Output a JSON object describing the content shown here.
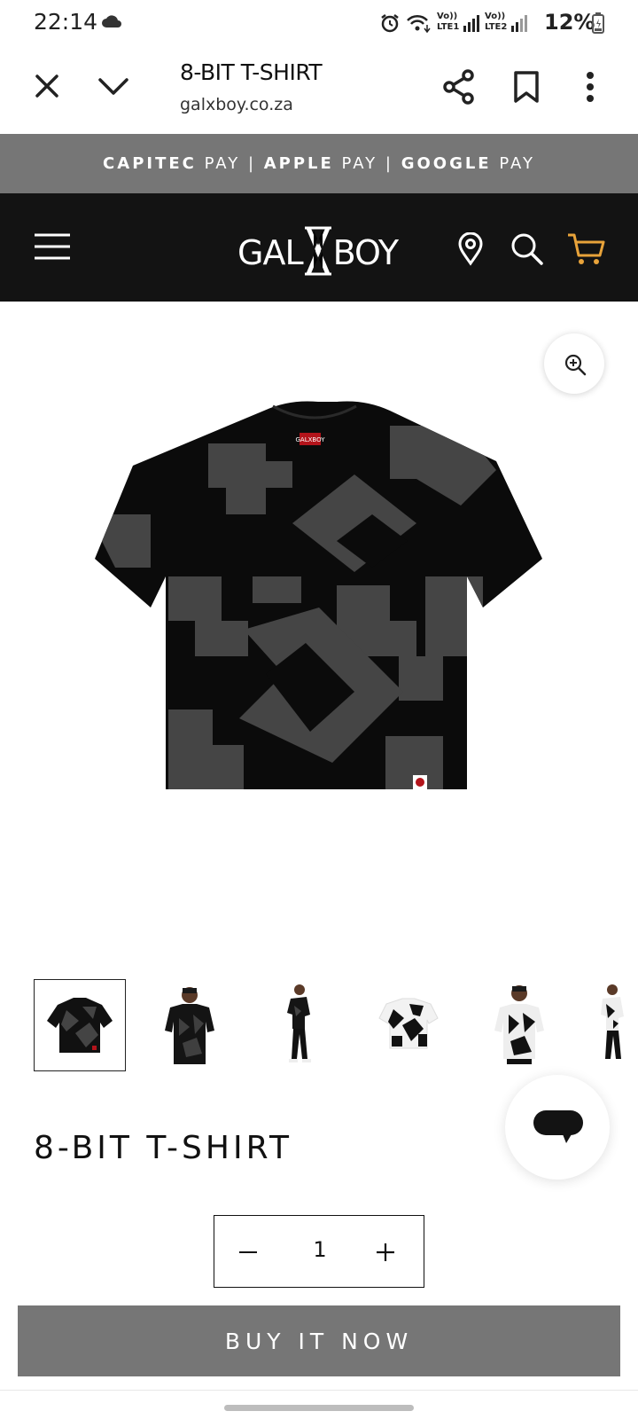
{
  "status_bar": {
    "time": "22:14",
    "battery": "12%",
    "sim1": {
      "volte": "Vo))",
      "type": "LTE1"
    },
    "sim2": {
      "volte": "Vo))",
      "type": "LTE2"
    },
    "icons": [
      "cloud-icon",
      "alarm-icon",
      "wifi-icon",
      "signal-icon",
      "battery-charging-icon"
    ]
  },
  "browser": {
    "title": "8-BIT T-SHIRT",
    "url": "galxboy.co.za",
    "icons": [
      "close-icon",
      "chevron-down-icon",
      "share-icon",
      "bookmark-icon",
      "more-vert-icon"
    ]
  },
  "promo": {
    "segments": [
      {
        "bold": "CAPITEC",
        "rest": " PAY"
      },
      {
        "bold": "APPLE",
        "rest": " PAY"
      },
      {
        "bold": "GOOGLE",
        "rest": " PAY"
      }
    ],
    "separator": " | "
  },
  "header": {
    "logo": "GALXBOY",
    "logo_left": "GAL",
    "logo_right": "BOY",
    "icons": [
      "menu-icon",
      "location-pin-icon",
      "search-icon",
      "cart-icon"
    ],
    "cart_color": "#e8a33a"
  },
  "product": {
    "title": "8-BIT T-SHIRT",
    "label_text": "GALXBOY",
    "quantity": "1",
    "buy_label": "BUY IT NOW",
    "thumbnails": [
      "tee-black-flat",
      "model-front-black",
      "model-side-black",
      "tee-white-flat",
      "model-front-white",
      "model-side-white"
    ],
    "selected_thumbnail": 0
  },
  "colors": {
    "promo_bg": "#767676",
    "header_bg": "#131313",
    "shirt_base": "#0b0b0b",
    "shirt_pattern": "#454545",
    "buy_bg": "#767676"
  }
}
